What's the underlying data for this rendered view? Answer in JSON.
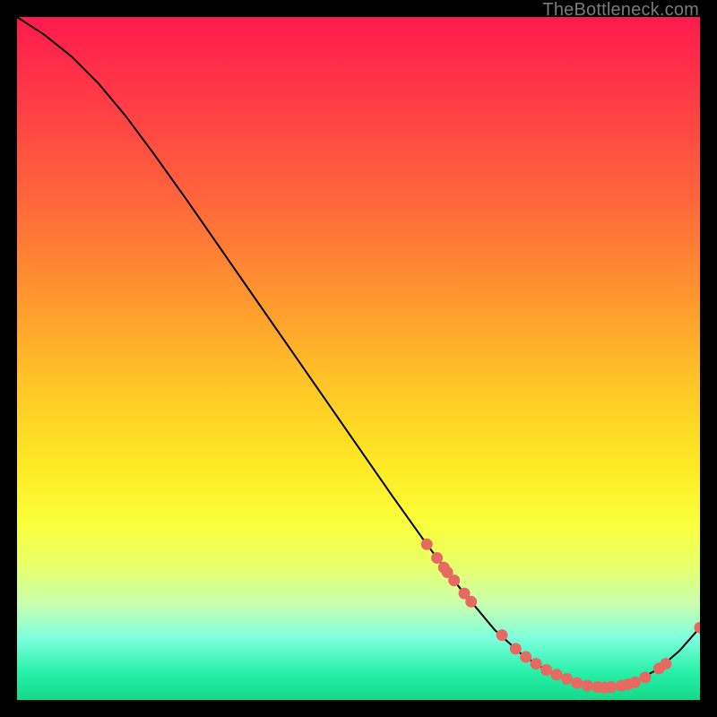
{
  "attribution": "TheBottleneck.com",
  "colors": {
    "dot": "#e66a62",
    "curve": "#000000"
  },
  "chart_data": {
    "type": "line",
    "title": "",
    "xlabel": "",
    "ylabel": "",
    "xlim": [
      0,
      100
    ],
    "ylim": [
      0,
      100
    ],
    "grid": false,
    "series": [
      {
        "name": "bottleneck-curve",
        "x": [
          0,
          4,
          8,
          12,
          16,
          20,
          25,
          30,
          35,
          40,
          45,
          50,
          55,
          60,
          65,
          70,
          74,
          78,
          82,
          86,
          90,
          94,
          97,
          100
        ],
        "y": [
          100,
          97.4,
          94.2,
          90.2,
          85.4,
          80.0,
          73.0,
          65.8,
          58.6,
          51.4,
          44.2,
          37.0,
          29.8,
          22.8,
          16.2,
          10.2,
          6.6,
          4.0,
          2.4,
          1.8,
          2.4,
          4.6,
          7.2,
          10.6
        ]
      }
    ],
    "highlight_points": {
      "name": "dots",
      "x": [
        60.0,
        61.5,
        62.5,
        63.0,
        64.0,
        65.5,
        66.5,
        71.0,
        73.0,
        74.5,
        76.0,
        77.5,
        79.0,
        80.5,
        82.0,
        83.5,
        85.0,
        86.0,
        87.0,
        88.5,
        89.5,
        90.5,
        92.0,
        94.0,
        95.0,
        100.0
      ],
      "y": [
        22.8,
        20.8,
        19.4,
        18.7,
        17.5,
        15.6,
        14.4,
        9.5,
        7.5,
        6.3,
        5.3,
        4.4,
        3.7,
        3.1,
        2.5,
        2.1,
        1.9,
        1.8,
        1.9,
        2.1,
        2.3,
        2.6,
        3.3,
        4.6,
        5.3,
        10.6
      ]
    }
  }
}
